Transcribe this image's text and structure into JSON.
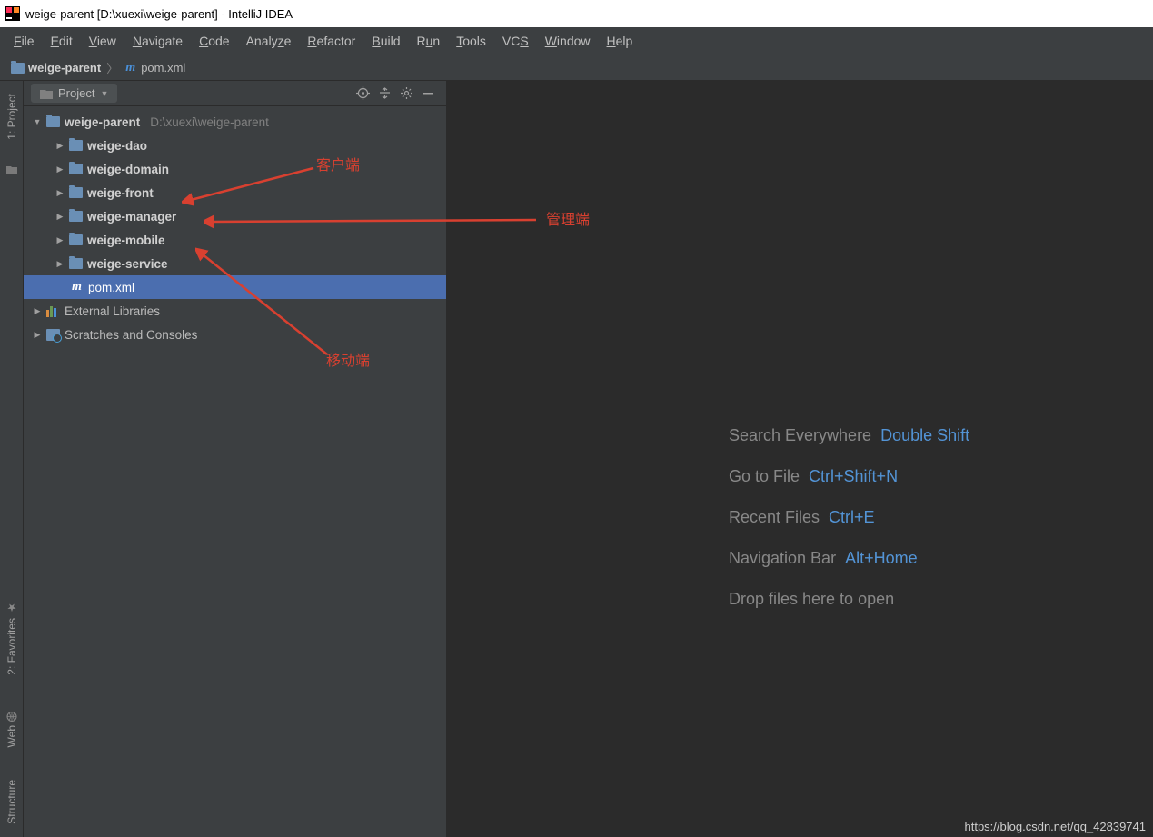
{
  "window": {
    "title": "weige-parent [D:\\xuexi\\weige-parent] - IntelliJ IDEA"
  },
  "menus": [
    "File",
    "Edit",
    "View",
    "Navigate",
    "Code",
    "Analyze",
    "Refactor",
    "Build",
    "Run",
    "Tools",
    "VCS",
    "Window",
    "Help"
  ],
  "breadcrumb": {
    "root": "weige-parent",
    "file": "pom.xml",
    "file_icon_glyph": "m"
  },
  "project_panel": {
    "title": "Project",
    "root": {
      "name": "weige-parent",
      "path": "D:\\xuexi\\weige-parent"
    },
    "modules": [
      "weige-dao",
      "weige-domain",
      "weige-front",
      "weige-manager",
      "weige-mobile",
      "weige-service"
    ],
    "file": {
      "name": "pom.xml",
      "icon_glyph": "m"
    },
    "extras": [
      "External Libraries",
      "Scratches and Consoles"
    ]
  },
  "gutter": {
    "top": {
      "label": "1: Project"
    },
    "bottom": [
      {
        "label": "2: Favorites"
      },
      {
        "label": "Web"
      },
      {
        "label": "Structure"
      }
    ]
  },
  "editor_hints": [
    {
      "label": "Search Everywhere",
      "shortcut": "Double Shift"
    },
    {
      "label": "Go to File",
      "shortcut": "Ctrl+Shift+N"
    },
    {
      "label": "Recent Files",
      "shortcut": "Ctrl+E"
    },
    {
      "label": "Navigation Bar",
      "shortcut": "Alt+Home"
    },
    {
      "label": "Drop files here to open",
      "shortcut": ""
    }
  ],
  "annotations": {
    "client": "客户端",
    "admin": "管理端",
    "mobile": "移动端"
  },
  "watermark": "https://blog.csdn.net/qq_42839741"
}
